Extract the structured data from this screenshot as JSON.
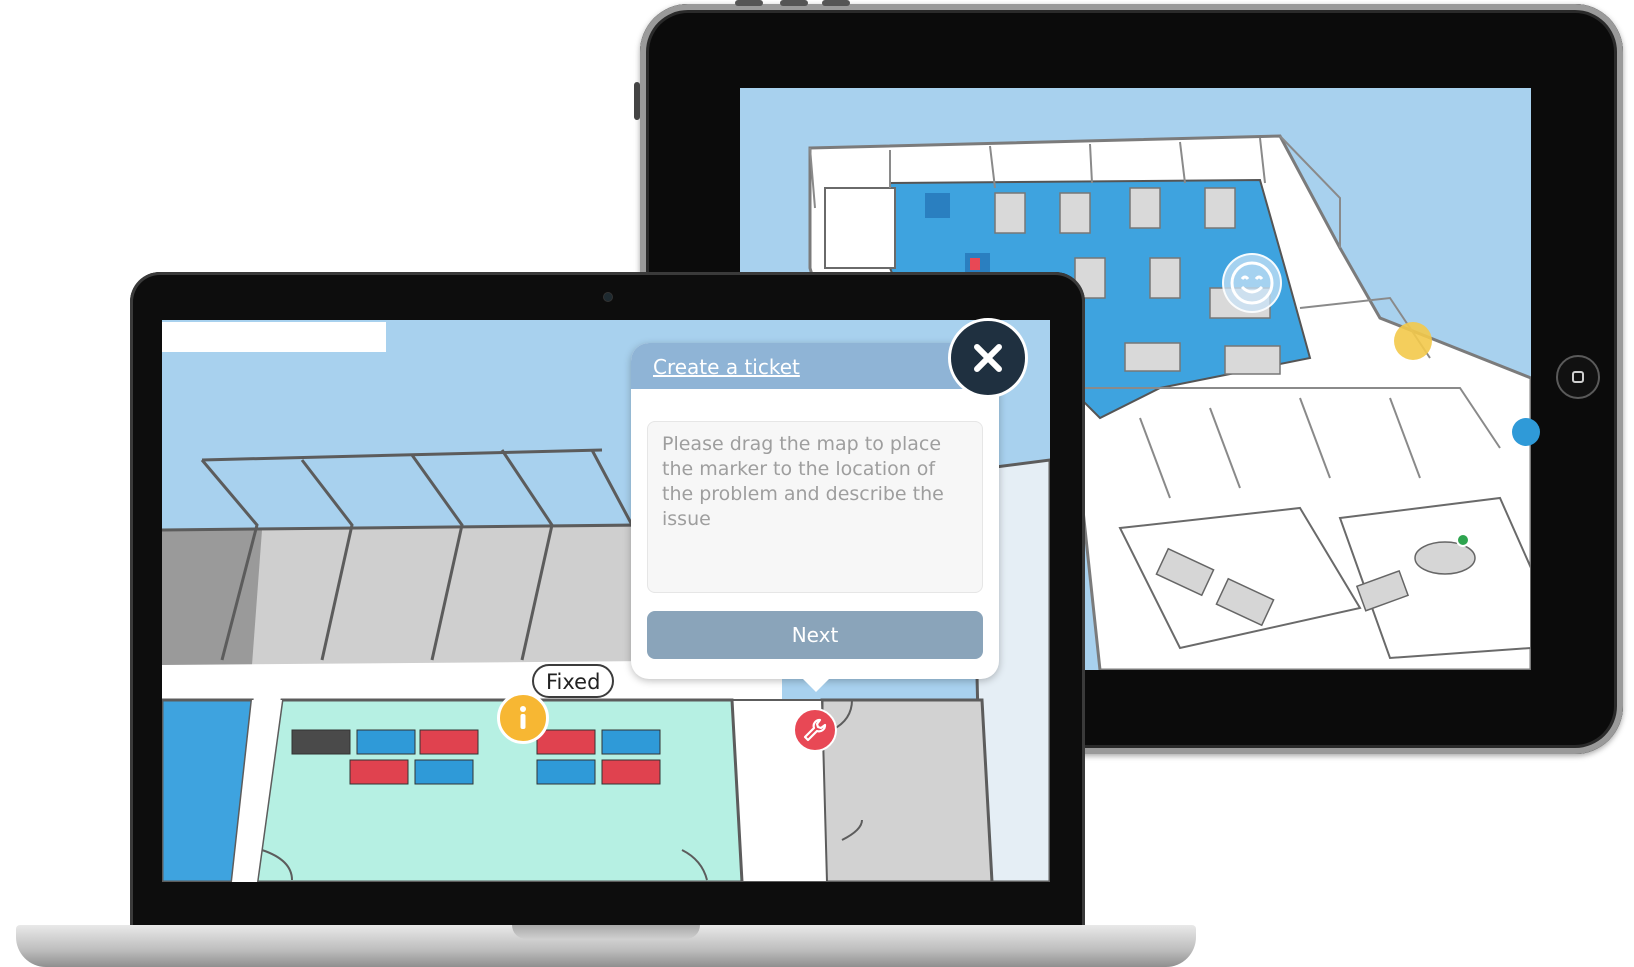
{
  "dialog": {
    "title": "Create a ticket",
    "description_placeholder": "Please drag the map to place the marker to the location of the problem and describe the issue",
    "next_label": "Next"
  },
  "markers": {
    "info_label": "Fixed",
    "info_icon": "info-icon",
    "wrench_icon": "wrench-icon",
    "smiley_icon": "smiley-icon"
  },
  "colors": {
    "dialog_header": "#8fb4d6",
    "next_button": "#8aa4ba",
    "close_button": "#1f3040",
    "info_marker": "#f7b733",
    "wrench_marker": "#e84855",
    "map_sky": "#a8d1ee"
  }
}
